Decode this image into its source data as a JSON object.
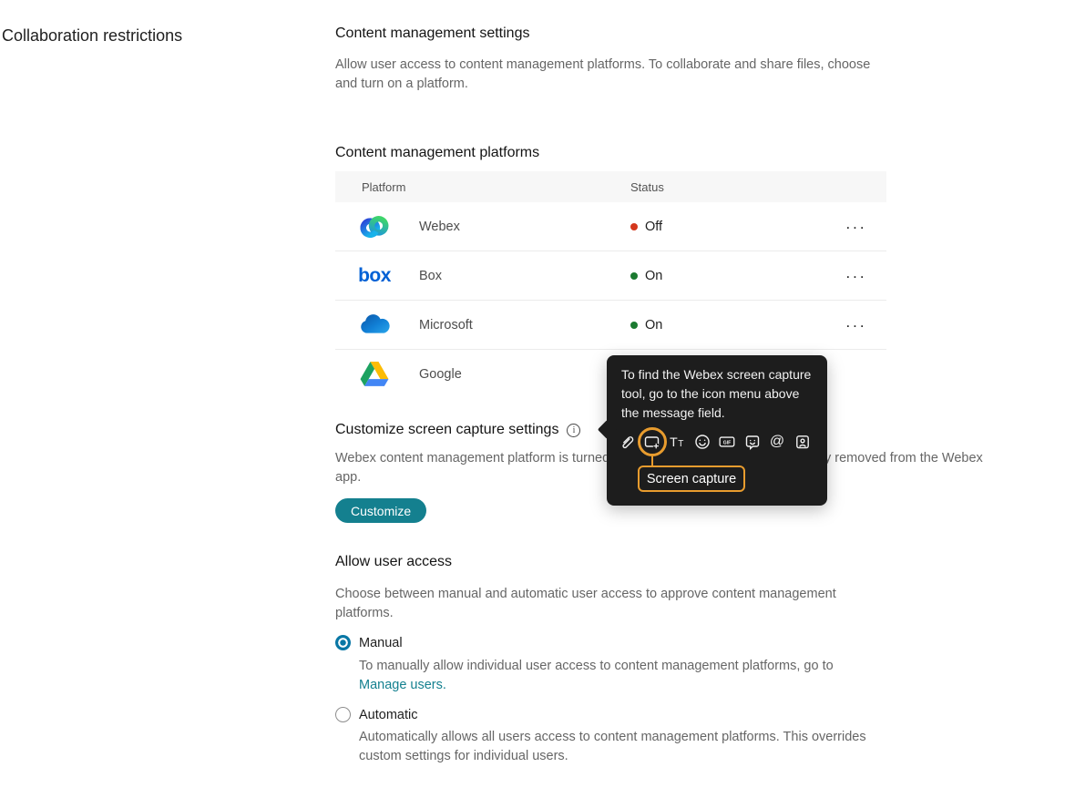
{
  "page": {
    "left_title": "Collaboration restrictions"
  },
  "content_settings": {
    "heading": "Content management settings",
    "description": "Allow user access to content management platforms. To collaborate and share files, choose and turn on a platform."
  },
  "platforms_section": {
    "heading": "Content management platforms",
    "columns": {
      "platform": "Platform",
      "status": "Status"
    },
    "menu_glyph": "···",
    "rows": [
      {
        "name": "Webex",
        "status": "Off",
        "status_color": "#D4371C",
        "icon": "webex-logo"
      },
      {
        "name": "Box",
        "status": "On",
        "status_color": "#1B7A30",
        "icon": "box-logo",
        "box_word": "box"
      },
      {
        "name": "Microsoft",
        "status": "On",
        "status_color": "#1B7A30",
        "icon": "onedrive-cloud"
      },
      {
        "name": "Google",
        "status": "",
        "status_color": "",
        "icon": "google-drive"
      }
    ]
  },
  "screen_capture_section": {
    "heading": "Customize screen capture settings",
    "info_glyph": "i",
    "description_line1_left": "Webex content management platform is turned",
    "description_line1_right": "y removed from the Webex",
    "description_line2": "app.",
    "customize_button": "Customize"
  },
  "tooltip": {
    "text": "To find the Webex screen capture tool, go to the icon menu above the message field.",
    "label": "Screen capture",
    "icon_names": [
      "attachment",
      "screen-capture",
      "text-format",
      "emoji",
      "gif",
      "sticker",
      "mention",
      "contact-card"
    ],
    "icon_labels": {
      "text_format": "Tt",
      "gif": "GIF",
      "mention": "@"
    },
    "bg_color": "#1D1D1D",
    "highlight_color": "#E89C2E"
  },
  "user_access_section": {
    "heading": "Allow user access",
    "description": "Choose between manual and automatic user access to approve content management platforms.",
    "options": [
      {
        "label": "Manual",
        "selected": true,
        "description": "To manually allow individual user access to content management platforms, go to",
        "link": "Manage users."
      },
      {
        "label": "Automatic",
        "selected": false,
        "description": "Automatically allows all users access to content management platforms. This overrides custom settings for individual users."
      }
    ]
  },
  "colors": {
    "accent_teal": "#14808F",
    "radio_selected": "#0977A5",
    "status_off": "#D4371C",
    "status_on": "#1B7A30",
    "box_blue": "#0061D5",
    "tooltip_bg": "#1D1D1D",
    "highlight_orange": "#E89C2E"
  }
}
